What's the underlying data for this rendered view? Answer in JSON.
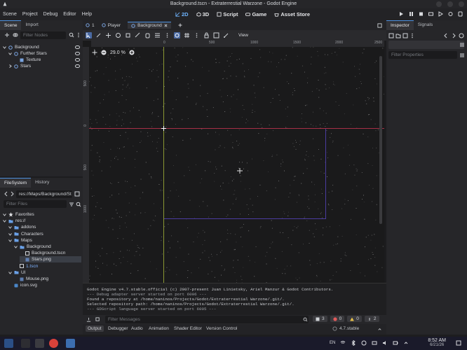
{
  "window": {
    "title": "Background.tscn - Extraterrestial Warzone - Godot Engine"
  },
  "menu": [
    "Scene",
    "Project",
    "Debug",
    "Editor",
    "Help"
  ],
  "workspaces": [
    {
      "label": "2D",
      "active": true
    },
    {
      "label": "3D",
      "active": false
    },
    {
      "label": "Script",
      "active": false
    },
    {
      "label": "Game",
      "active": false
    },
    {
      "label": "Asset Store",
      "active": false
    }
  ],
  "scene_dock": {
    "tabs": [
      "Scene",
      "Import"
    ],
    "filter_placeholder": "Filter Nodes",
    "nodes": [
      {
        "label": "Background",
        "depth": 0,
        "icon": "node2d-icon"
      },
      {
        "label": "Further Stars",
        "depth": 1,
        "icon": "node2d-icon"
      },
      {
        "label": "Texture",
        "depth": 2,
        "icon": "sprite-icon"
      },
      {
        "label": "Stars",
        "depth": 1,
        "icon": "node2d-icon"
      }
    ]
  },
  "filesystem": {
    "tabs": [
      "FileSystem",
      "History"
    ],
    "path": "res://Maps/Background/St",
    "filter_placeholder": "Filter Files",
    "items": [
      {
        "label": "Favorites",
        "depth": 0,
        "icon": "star-icon"
      },
      {
        "label": "res://",
        "depth": 0,
        "icon": "folder-icon"
      },
      {
        "label": "addons",
        "depth": 1,
        "icon": "folder-icon"
      },
      {
        "label": "Characters",
        "depth": 1,
        "icon": "folder-icon"
      },
      {
        "label": "Maps",
        "depth": 1,
        "icon": "folder-icon"
      },
      {
        "label": "Background",
        "depth": 2,
        "icon": "folder-icon"
      },
      {
        "label": "Background.tscn",
        "depth": 3,
        "icon": "scene-file-icon"
      },
      {
        "label": "Stars.png",
        "depth": 3,
        "icon": "image-file-icon",
        "selected": true
      },
      {
        "label": "1.tscn",
        "depth": 2,
        "icon": "scene-file-icon"
      },
      {
        "label": "UI",
        "depth": 1,
        "icon": "folder-icon"
      },
      {
        "label": "Mouse.png",
        "depth": 2,
        "icon": "image-file-icon"
      },
      {
        "label": "icon.svg",
        "depth": 1,
        "icon": "svg-file-icon"
      }
    ]
  },
  "scene_tabs": [
    "1",
    "Player",
    "Background"
  ],
  "toolbar": {
    "view_label": "View"
  },
  "viewport": {
    "zoom": "29.0 %",
    "ruler_top": [
      "0",
      "500",
      "1000",
      "1500",
      "2000",
      "2500"
    ],
    "ruler_left": [
      "500",
      "0",
      "500",
      "1000"
    ]
  },
  "output": {
    "lines": [
      "Godot Engine v4.7.stable.official (c) 2007-present Juan Linietsky, Ariel Manzur & Godot Contributors.",
      "--- Debug adapter server started on port 6006 ---",
      "Found a repository at /home/naninos/Projects/Godot/Extraterrestial Warzone/.git/.",
      "Selected repository path: /home/naninos/Projects/Godot/Extraterrestial Warzone/.git/.",
      "--- GDScript language server started on port 6005 ---"
    ],
    "filter_placeholder": "Filter Messages",
    "counts": {
      "log": "3",
      "errors": "0",
      "warnings": "0",
      "info": "2"
    }
  },
  "bottom_tabs": [
    "Output",
    "Debugger",
    "Audio",
    "Animation",
    "Shader Editor",
    "Version Control"
  ],
  "version": "4.7.stable",
  "inspector": {
    "tabs": [
      "Inspector",
      "Signals"
    ],
    "filter_placeholder": "Filter Properties"
  },
  "taskbar": {
    "lang": "EN",
    "time": "8:52 AM",
    "date": "6/21/26"
  },
  "colors": {
    "accent": "#4d92e0",
    "axis_x": "#c0344d",
    "axis_y": "#a8b83a",
    "frame": "#4b3ca0"
  }
}
